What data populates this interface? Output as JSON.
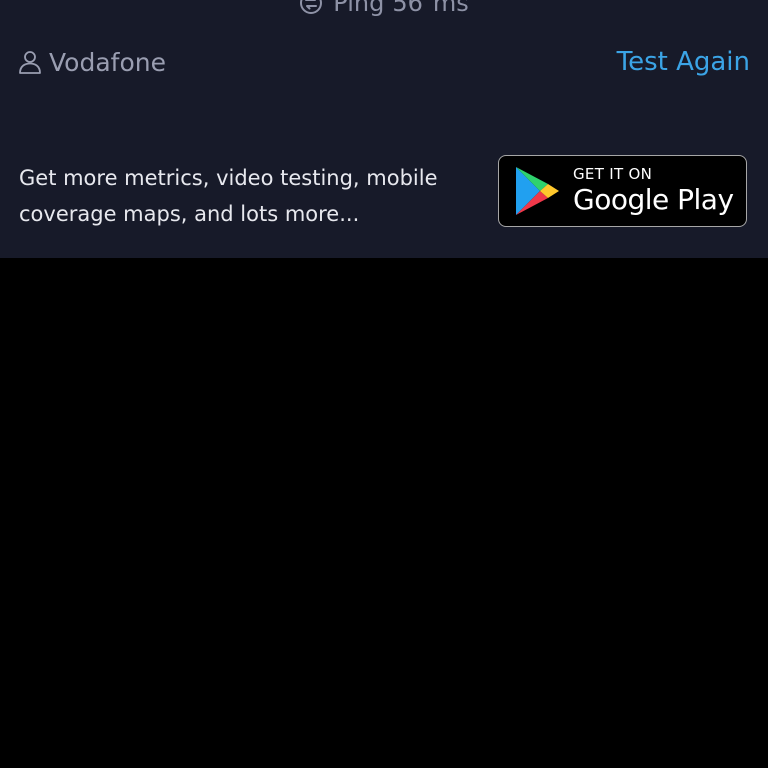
{
  "ping": {
    "label": "Ping",
    "value": "56",
    "unit": "ms",
    "icon": "ping-icon"
  },
  "provider": {
    "name": "Vodafone",
    "icon": "person-icon"
  },
  "actions": {
    "test_again_label": "Test Again"
  },
  "promo": {
    "text": "Get more metrics, video testing, mobile coverage maps, and lots more..."
  },
  "play_badge": {
    "small_text": "GET IT ON",
    "large_text": "Google Play",
    "icon": "google-play-icon"
  },
  "colors": {
    "panel_background": "#171a29",
    "page_background": "#000000",
    "accent": "#3ba4e6",
    "muted_text": "#9a9eb1",
    "body_text": "#e7e8ee"
  }
}
